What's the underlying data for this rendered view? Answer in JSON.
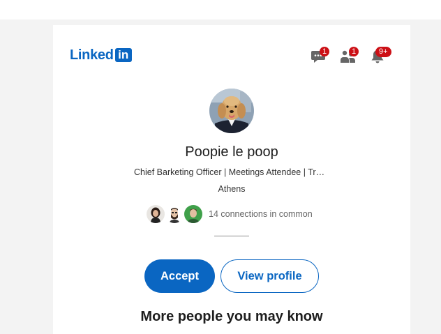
{
  "header": {
    "logo_text": "Linked",
    "logo_box_text": "in",
    "brand_color": "#0a66c2",
    "messages_badge": "1",
    "network_badge": "1",
    "notifications_badge": "9+"
  },
  "profile": {
    "name": "Poopie le poop",
    "headline": "Chief Barketing Officer | Meetings Attendee | Treat Negotiator",
    "location": "Athens",
    "mutual_connections_text": "14 connections in common"
  },
  "actions": {
    "accept_label": "Accept",
    "view_profile_label": "View profile"
  },
  "section": {
    "more_people_title": "More people you may know"
  },
  "colors": {
    "badge": "#cc1016",
    "icon_gray": "#666666",
    "background": "#f3f3f3"
  },
  "icons": {
    "messages": "messages-icon",
    "network": "my-network-icon",
    "notifications": "bell-icon"
  }
}
